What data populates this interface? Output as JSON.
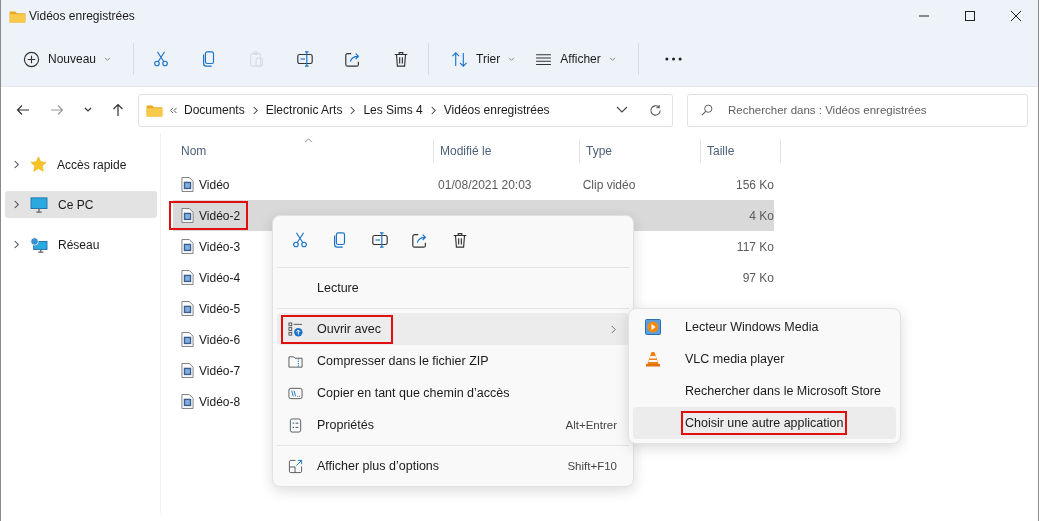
{
  "window": {
    "title": "Vidéos enregistrées"
  },
  "toolbar": {
    "new_button": {
      "label": "Nouveau"
    },
    "actions": [
      {
        "kind": "cut",
        "disabled": false
      },
      {
        "kind": "copy",
        "disabled": false
      },
      {
        "kind": "paste",
        "disabled": true
      },
      {
        "kind": "rename",
        "disabled": false
      },
      {
        "kind": "share",
        "disabled": false
      },
      {
        "kind": "delete",
        "disabled": false
      }
    ],
    "sort_button": {
      "label": "Trier"
    },
    "view_button": {
      "label": "Afficher"
    }
  },
  "address_bar": {
    "breadcrumbs": [
      "Documents",
      "Electronic Arts",
      "Les Sims 4",
      "Vidéos enregistrées"
    ]
  },
  "search": {
    "placeholder": "Rechercher dans : Vidéos enregistrées"
  },
  "sidebar": {
    "items": [
      {
        "label": "Accès rapide",
        "kind": "star",
        "selected": false
      },
      {
        "label": "Ce PC",
        "kind": "pc",
        "selected": true
      },
      {
        "label": "Réseau",
        "kind": "network",
        "selected": false
      }
    ]
  },
  "table": {
    "columns": [
      "Nom",
      "Modifié le",
      "Type",
      "Taille"
    ],
    "rows": [
      {
        "name": "Vidéo",
        "modified": "01/08/2021 20:03",
        "type": "Clip vidéo",
        "size": "156 Ko",
        "selected": false,
        "annotated": false
      },
      {
        "name": "Vidéo-2",
        "size": "4 Ko",
        "selected": true,
        "annotated": true
      },
      {
        "name": "Vidéo-3",
        "size": "117 Ko",
        "selected": false,
        "annotated": false
      },
      {
        "name": "Vidéo-4",
        "size": "97 Ko",
        "selected": false,
        "annotated": false
      },
      {
        "name": "Vidéo-5",
        "selected": false,
        "annotated": false
      },
      {
        "name": "Vidéo-6",
        "selected": false,
        "annotated": false
      },
      {
        "name": "Vidéo-7",
        "selected": false,
        "annotated": false
      },
      {
        "name": "Vidéo-8",
        "selected": false,
        "annotated": false
      }
    ]
  },
  "context_menu": {
    "quick_actions": [
      {
        "kind": "cut"
      },
      {
        "kind": "copy"
      },
      {
        "kind": "rename"
      },
      {
        "kind": "share"
      },
      {
        "kind": "delete"
      }
    ],
    "sections": [
      [
        {
          "label": "Lecture",
          "kind": "plain",
          "selected": false,
          "annotated": false,
          "submenu": false
        }
      ],
      [
        {
          "label": "Ouvrir avec",
          "kind": "open-with",
          "selected": true,
          "annotated": true,
          "submenu": true
        },
        {
          "label": "Compresser dans le fichier ZIP",
          "kind": "zip",
          "selected": false,
          "annotated": false,
          "submenu": false
        },
        {
          "label": "Copier en tant que chemin d’accès",
          "kind": "path",
          "selected": false,
          "annotated": false,
          "submenu": false
        },
        {
          "label": "Propriétés",
          "kind": "properties",
          "shortcut": "Alt+Entrer",
          "selected": false,
          "annotated": false,
          "submenu": false
        }
      ],
      [
        {
          "label": "Afficher plus d’options",
          "kind": "more-options",
          "shortcut": "Shift+F10",
          "selected": false,
          "annotated": false,
          "submenu": false
        }
      ]
    ]
  },
  "submenu": {
    "items": [
      {
        "label": "Lecteur Windows Media",
        "kind": "media",
        "selected": false,
        "annotated": false
      },
      {
        "label": "VLC media player",
        "kind": "cone",
        "selected": false,
        "annotated": false
      },
      {
        "label": "Rechercher dans le Microsoft Store",
        "kind": "plain",
        "selected": false,
        "annotated": false
      },
      {
        "label": "Choisir une autre application",
        "kind": "plain",
        "selected": true,
        "annotated": true
      }
    ]
  }
}
